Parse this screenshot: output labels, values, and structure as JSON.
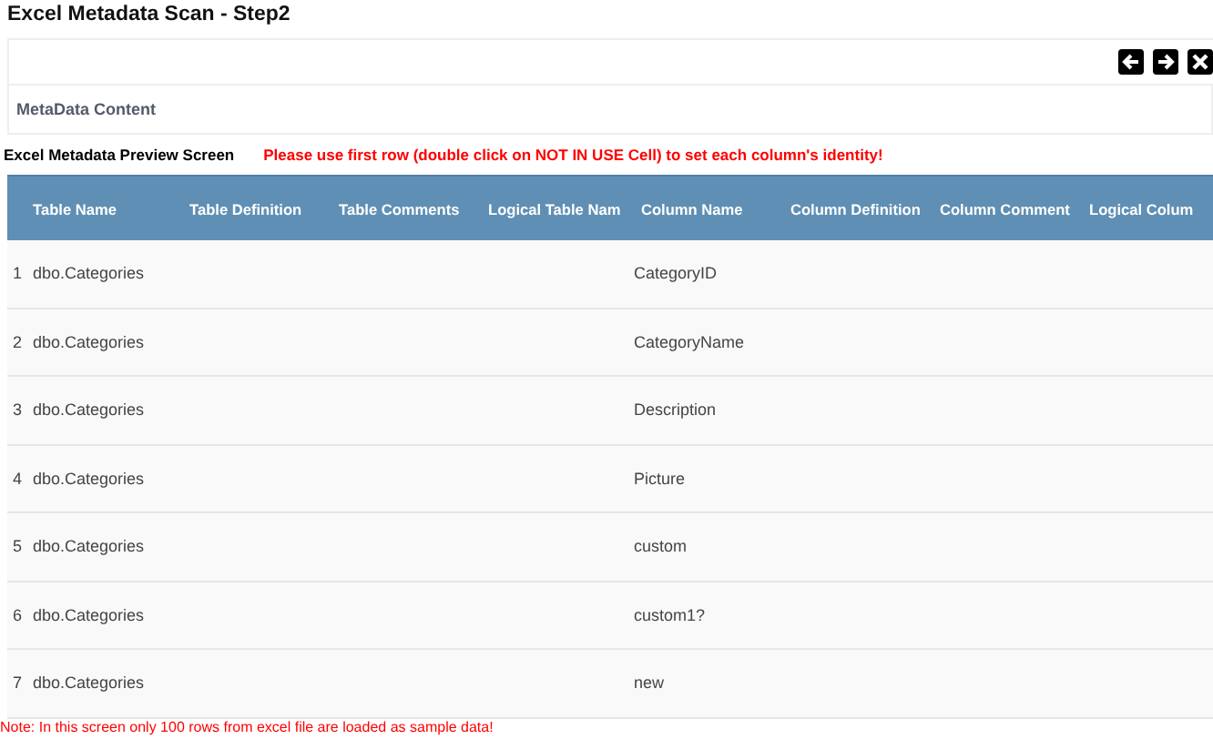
{
  "window": {
    "title": "Excel Metadata Scan - Step2"
  },
  "toolbar": {
    "buttons": [
      {
        "kind": "back"
      },
      {
        "kind": "forward"
      },
      {
        "kind": "close"
      }
    ]
  },
  "section_title": "MetaData Content",
  "preview": {
    "label": "Excel Metadata Preview Screen",
    "instruction": "Please use first row (double click on NOT IN USE Cell) to set each column's identity!"
  },
  "table": {
    "columns": [
      "Table Name",
      "Table Definition",
      "Table Comments",
      "Logical Table Nam",
      "Column Name",
      "Column Definition",
      "Column Comment",
      "Logical Colum"
    ],
    "rows": [
      {
        "number": "1",
        "table_name": "dbo.Categories",
        "column_name": "CategoryID"
      },
      {
        "number": "2",
        "table_name": "dbo.Categories",
        "column_name": "CategoryName"
      },
      {
        "number": "3",
        "table_name": "dbo.Categories",
        "column_name": "Description"
      },
      {
        "number": "4",
        "table_name": "dbo.Categories",
        "column_name": "Picture"
      },
      {
        "number": "5",
        "table_name": "dbo.Categories",
        "column_name": "custom"
      },
      {
        "number": "6",
        "table_name": "dbo.Categories",
        "column_name": "custom1?"
      },
      {
        "number": "7",
        "table_name": "dbo.Categories",
        "column_name": "new"
      }
    ]
  },
  "note": "Note: In this screen only 100 rows from excel file are loaded as sample data!"
}
